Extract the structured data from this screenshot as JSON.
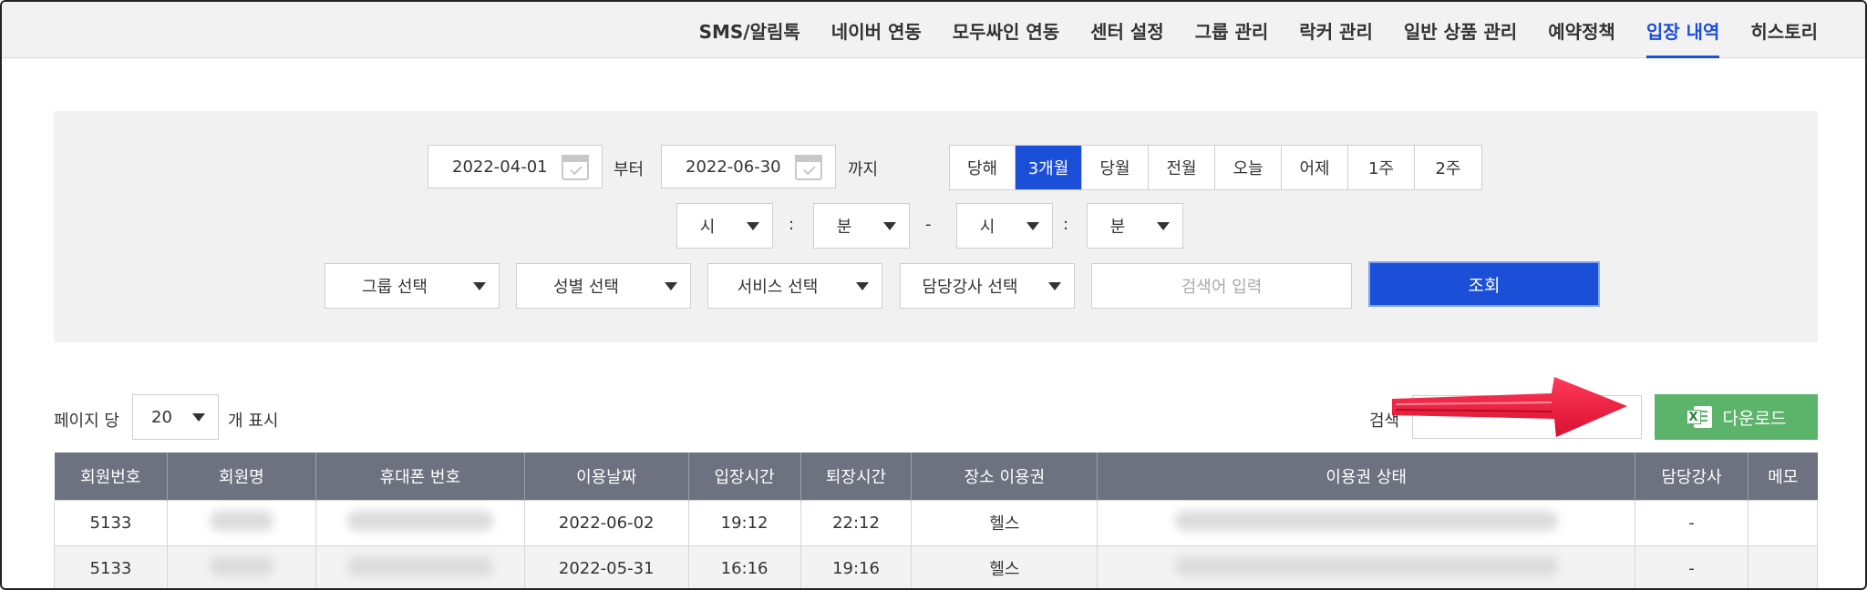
{
  "nav": {
    "items": [
      {
        "label": "SMS/알림톡",
        "active": false
      },
      {
        "label": "네이버 연동",
        "active": false
      },
      {
        "label": "모두싸인 연동",
        "active": false
      },
      {
        "label": "센터 설정",
        "active": false
      },
      {
        "label": "그룹 관리",
        "active": false
      },
      {
        "label": "락커 관리",
        "active": false
      },
      {
        "label": "일반 상품 관리",
        "active": false
      },
      {
        "label": "예약정책",
        "active": false
      },
      {
        "label": "입장 내역",
        "active": true
      },
      {
        "label": "히스토리",
        "active": false
      }
    ]
  },
  "filter": {
    "start_date": "2022-04-01",
    "from_label": "부터",
    "end_date": "2022-06-30",
    "to_label": "까지",
    "periods": [
      {
        "label": "당해",
        "selected": false
      },
      {
        "label": "3개월",
        "selected": true
      },
      {
        "label": "당월",
        "selected": false
      },
      {
        "label": "전월",
        "selected": false
      },
      {
        "label": "오늘",
        "selected": false
      },
      {
        "label": "어제",
        "selected": false
      },
      {
        "label": "1주",
        "selected": false
      },
      {
        "label": "2주",
        "selected": false
      }
    ],
    "time": {
      "start_hour": "시",
      "colon1": ":",
      "start_min": "분",
      "dash": "-",
      "end_hour": "시",
      "colon2": ":",
      "end_min": "분"
    },
    "group_select": "그룹 선택",
    "gender_select": "성별 선택",
    "service_select": "서비스 선택",
    "instructor_select": "담당강사 선택",
    "search_placeholder": "검색어 입력",
    "query_button": "조회"
  },
  "list": {
    "per_page_label": "페이지 당",
    "per_page_value": "20",
    "per_page_suffix": "개 표시",
    "search_label": "검색",
    "download_label": "다운로드"
  },
  "table": {
    "headers": [
      "회원번호",
      "회원명",
      "휴대폰 번호",
      "이용날짜",
      "입장시간",
      "퇴장시간",
      "장소 이용권",
      "이용권 상태",
      "담당강사",
      "메모"
    ],
    "rows": [
      {
        "member_no": "5133",
        "date": "2022-06-02",
        "in_time": "19:12",
        "out_time": "22:12",
        "place_pass": "헬스",
        "instructor": "-",
        "memo": ""
      },
      {
        "member_no": "5133",
        "date": "2022-05-31",
        "in_time": "16:16",
        "out_time": "19:16",
        "place_pass": "헬스",
        "instructor": "-",
        "memo": ""
      }
    ]
  },
  "colors": {
    "accent": "#1c4fd7",
    "download": "#5cb46a",
    "table_header": "#6e7280",
    "annotation_arrow": "#e8153a"
  },
  "icons": {
    "calendar": "calendar-icon",
    "dropdown": "chevron-down-icon",
    "excel": "excel-icon",
    "arrow": "red-arrow-annotation"
  }
}
